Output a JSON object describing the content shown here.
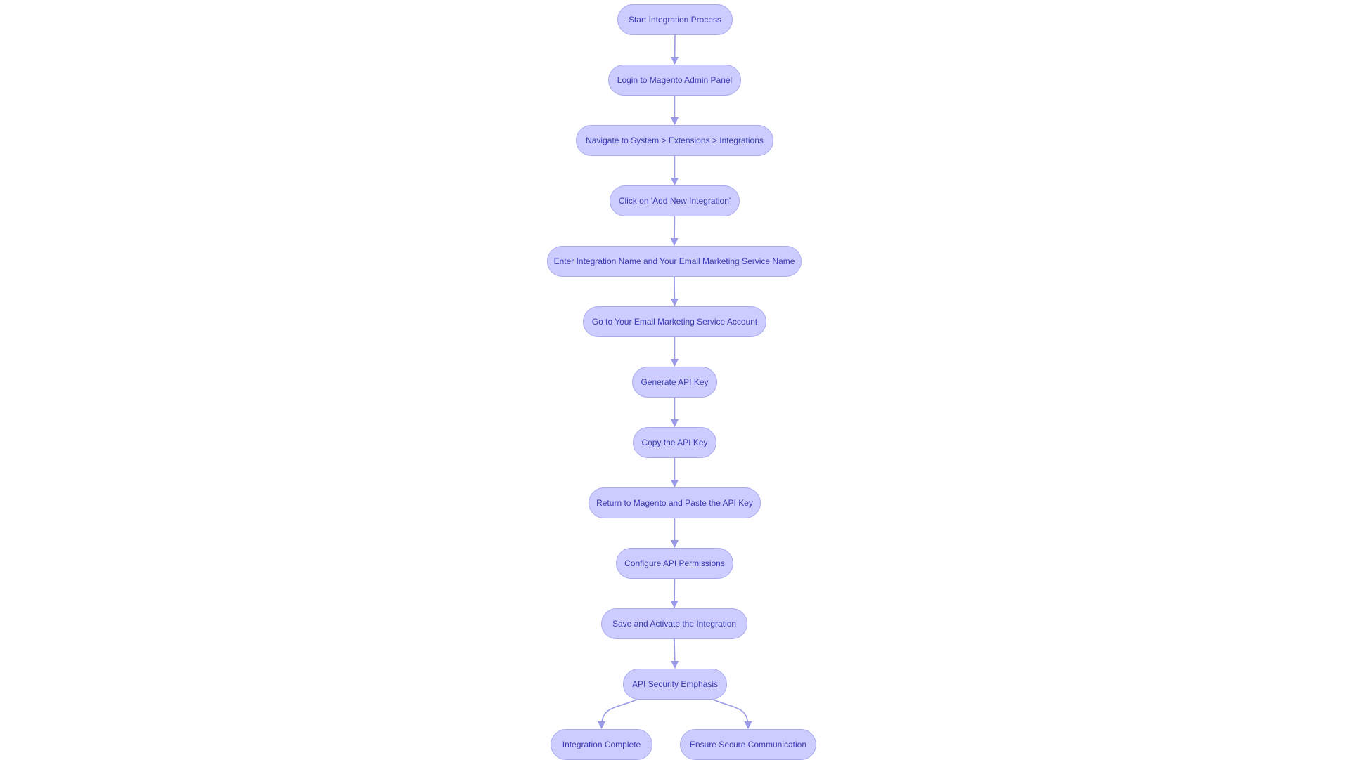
{
  "diagram": {
    "type": "flowchart",
    "direction": "top-down",
    "colors": {
      "node_fill": "#ccccff",
      "node_border": "#a9a9ee",
      "text": "#3a3ab0",
      "edge": "#9a9ae8"
    },
    "nodes": [
      {
        "id": "start",
        "label": "Start Integration Process"
      },
      {
        "id": "login",
        "label": "Login to Magento Admin Panel"
      },
      {
        "id": "navigate",
        "label": "Navigate to System > Extensions > Integrations"
      },
      {
        "id": "add",
        "label": "Click on 'Add New Integration'"
      },
      {
        "id": "enter",
        "label": "Enter Integration Name and Your Email Marketing Service Name"
      },
      {
        "id": "goto",
        "label": "Go to Your Email Marketing Service Account"
      },
      {
        "id": "generate",
        "label": "Generate API Key"
      },
      {
        "id": "copy",
        "label": "Copy the API Key"
      },
      {
        "id": "paste",
        "label": "Return to Magento and Paste the API Key"
      },
      {
        "id": "configure",
        "label": "Configure API Permissions"
      },
      {
        "id": "save",
        "label": "Save and Activate the Integration"
      },
      {
        "id": "security",
        "label": "API Security Emphasis"
      },
      {
        "id": "complete",
        "label": "Integration Complete"
      },
      {
        "id": "secure",
        "label": "Ensure Secure Communication"
      }
    ],
    "edges": [
      [
        "start",
        "login"
      ],
      [
        "login",
        "navigate"
      ],
      [
        "navigate",
        "add"
      ],
      [
        "add",
        "enter"
      ],
      [
        "enter",
        "goto"
      ],
      [
        "goto",
        "generate"
      ],
      [
        "generate",
        "copy"
      ],
      [
        "copy",
        "paste"
      ],
      [
        "paste",
        "configure"
      ],
      [
        "configure",
        "save"
      ],
      [
        "save",
        "security"
      ],
      [
        "security",
        "complete"
      ],
      [
        "security",
        "secure"
      ]
    ]
  }
}
